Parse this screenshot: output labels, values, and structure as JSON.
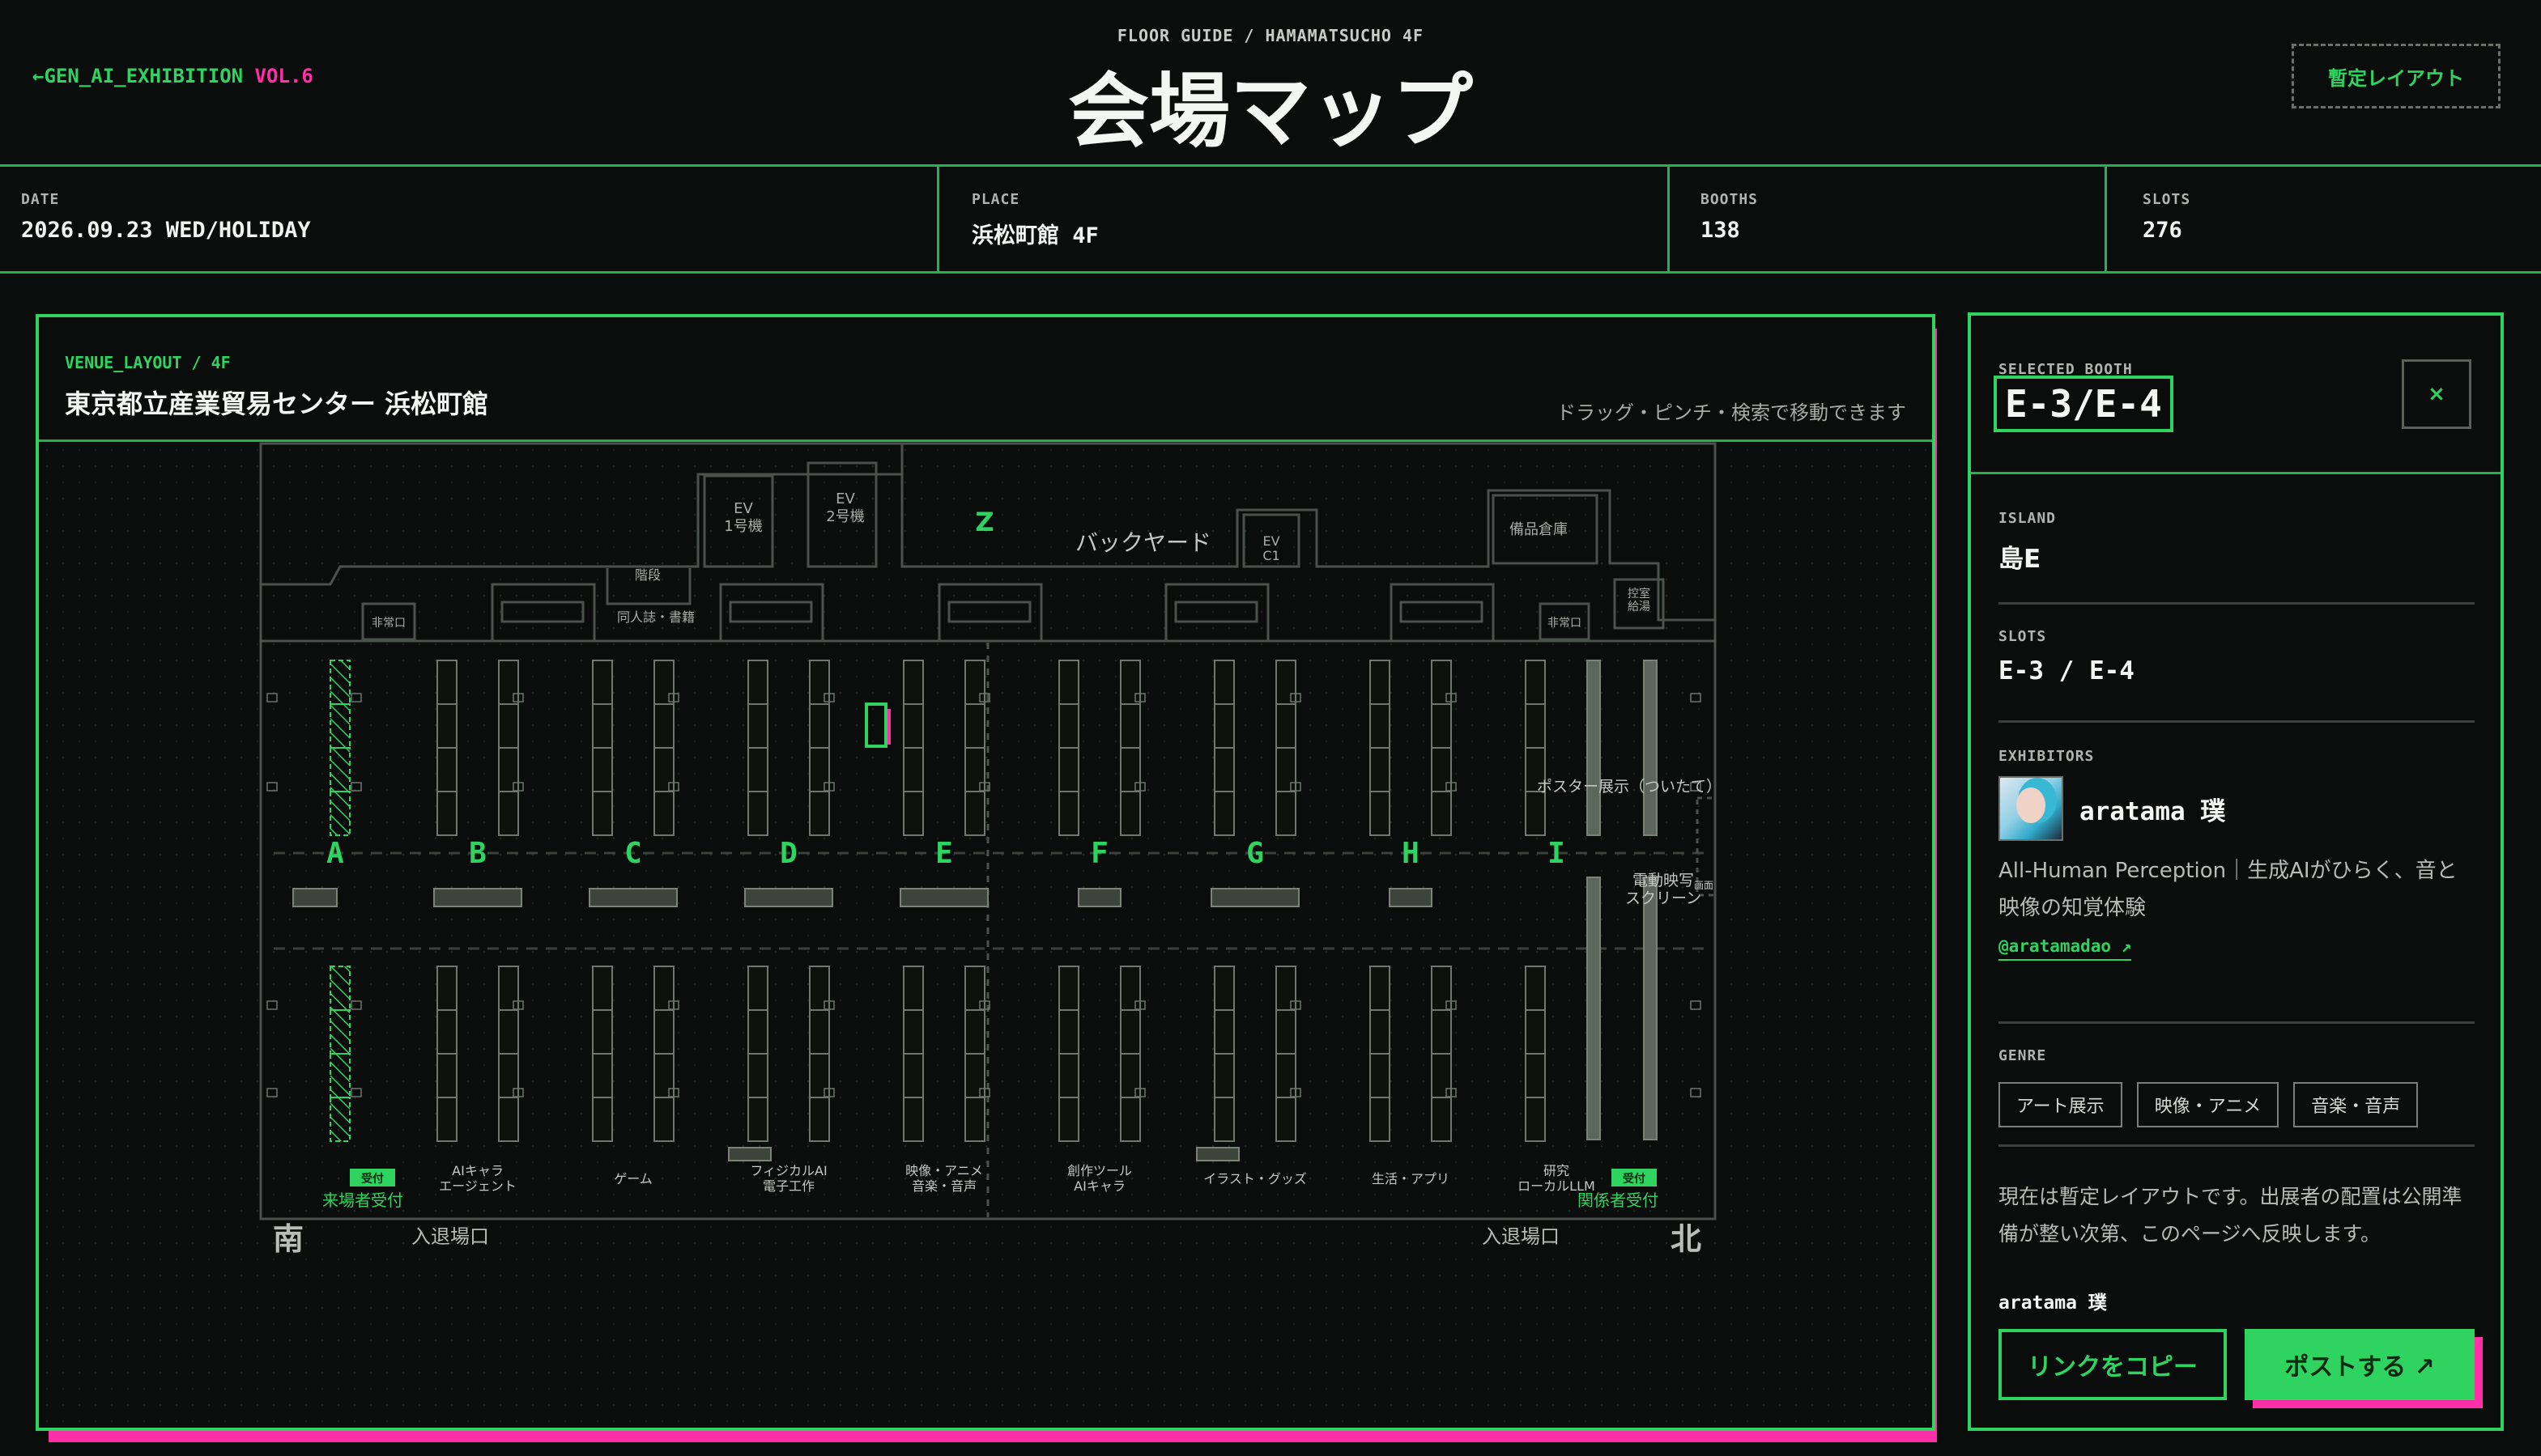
{
  "header": {
    "back_arrow": "←",
    "back_label": "GEN_AI_EXHIBITION",
    "back_vol": "VOL.6",
    "subtitle": "FLOOR GUIDE / HAMAMATSUCHO 4F",
    "title": "会場マップ",
    "tentative_button": "暫定レイアウト"
  },
  "info": [
    {
      "label": "DATE",
      "value": "2026.09.23 WED/HOLIDAY"
    },
    {
      "label": "PLACE",
      "value": "浜松町館 4F"
    },
    {
      "label": "BOOTHS",
      "value": "138"
    },
    {
      "label": "SLOTS",
      "value": "276"
    }
  ],
  "map": {
    "tag": "VENUE_LAYOUT / 4F",
    "venue": "東京都立産業貿易センター 浜松町館",
    "hint": "ドラッグ・ピンチ・検索で移動できます",
    "rooms": {
      "ev1": [
        "EV",
        "1号機"
      ],
      "ev2": [
        "EV",
        "2号機"
      ],
      "evc1": [
        "EV",
        "C1"
      ],
      "stairs": "階段",
      "zone_z": "Z",
      "backyard": "バックヤード",
      "storage": "備品倉庫",
      "control": [
        "控室",
        "給湯"
      ],
      "emergency": "非常口",
      "doujin": "同人誌・書籍"
    },
    "islands": [
      "A",
      "B",
      "C",
      "D",
      "E",
      "F",
      "G",
      "H",
      "I"
    ],
    "genres": [
      [
        "AIキャラ",
        "エージェント"
      ],
      [
        "ゲーム"
      ],
      [
        "フィジカルAI",
        "電子工作"
      ],
      [
        "映像・アニメ",
        "音楽・音声"
      ],
      [
        "創作ツール",
        "AIキャラ"
      ],
      [
        "イラスト・グッズ"
      ],
      [
        "生活・アプリ"
      ],
      [
        "研究",
        "ローカルLLM"
      ]
    ],
    "poster_label": "ポスター展示（ついたて）",
    "screen_label": [
      "電動映写",
      "スクリーン"
    ],
    "screen_side": "画面",
    "visitor_reception": "来場者受付",
    "staff_reception": "関係者受付",
    "reception_tag": "受付",
    "south": "南",
    "north": "北",
    "entrance_left": "入退場口",
    "entrance_right": "入退場口"
  },
  "selected": {
    "label": "SELECTED BOOTH",
    "id": "E-3/E-4",
    "close": "×",
    "island_label": "ISLAND",
    "island": "島E",
    "slots_label": "SLOTS",
    "slots": "E-3 / E-4",
    "exhibitors_label": "EXHIBITORS",
    "exhibitor_name": "aratama 璞",
    "exhibitor_desc": "All-Human Perception｜生成AIがひらく、音と映像の知覚体験",
    "exhibitor_link": "@aratamadao ↗",
    "genre_label": "GENRE",
    "genres": [
      "アート展示",
      "映像・アニメ",
      "音楽・音声"
    ],
    "notice": "現在は暫定レイアウトです。出展者の配置は公開準備が整い次第、このページへ反映します。",
    "author": "aratama 璞",
    "copy_button": "リンクをコピー",
    "post_button": "ポストする ↗"
  },
  "colors": {
    "accent": "#2fd35f",
    "pink": "#ff2fa8",
    "background": "#0b0c0c"
  }
}
